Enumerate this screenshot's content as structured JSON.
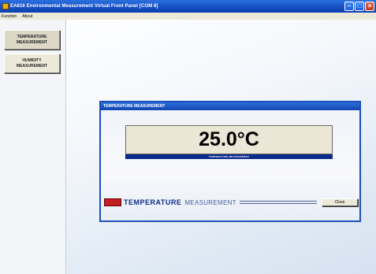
{
  "window": {
    "title": "EA816 Environmental Measurement Virtual Front Panel [COM 8]"
  },
  "menu": {
    "items": [
      {
        "label": "Function"
      },
      {
        "label": "About"
      }
    ]
  },
  "sidebar": {
    "buttons": [
      {
        "line1": "TEMPERATURE",
        "line2": "MEASUREMENT"
      },
      {
        "line1": "HUMIDITY",
        "line2": "MEASUREMENT"
      }
    ]
  },
  "dialog": {
    "title": "TEMPERATURE MEASUREMENT",
    "reading": "25.0°C",
    "caption": "TEMPERATURE MEASUREMENT",
    "footer_strong": "TEMPERATURE",
    "footer_light": "MEASUREMENT",
    "close_label": "Close"
  },
  "colors": {
    "titlebar": "#1a55c8",
    "dialog_border": "#1c4fb8",
    "caption_bar": "#0a2a8c",
    "brand_red": "#c02020"
  }
}
